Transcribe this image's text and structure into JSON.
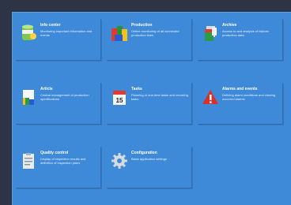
{
  "tiles": [
    {
      "key": "info",
      "title": "Info center",
      "desc": "Monitoring important information and events",
      "icon": "database-info-icon"
    },
    {
      "key": "production",
      "title": "Production",
      "desc": "Online monitoring of all connected production lines",
      "icon": "colored-blocks-icon"
    },
    {
      "key": "archive",
      "title": "Archive",
      "desc": "Access to and analysis of historic production data",
      "icon": "archive-stack-icon"
    },
    {
      "key": "article",
      "title": "Article",
      "desc": "Central management of production specifications",
      "icon": "document-article-icon"
    },
    {
      "key": "tasks",
      "title": "Tasks",
      "desc": "Planning of one-time tasks and recurring tasks",
      "icon": "calendar-icon"
    },
    {
      "key": "alarms",
      "title": "Alarms and events",
      "desc": "Defining alarm conditions and viewing occurred alarms",
      "icon": "warning-icon"
    },
    {
      "key": "quality",
      "title": "Quality control",
      "desc": "Display of inspection results and definition of inspection plans",
      "icon": "clipboard-icon"
    },
    {
      "key": "config",
      "title": "Configuration",
      "desc": "Basic application settings",
      "icon": "gear-icon"
    }
  ],
  "calendar_day": "15"
}
